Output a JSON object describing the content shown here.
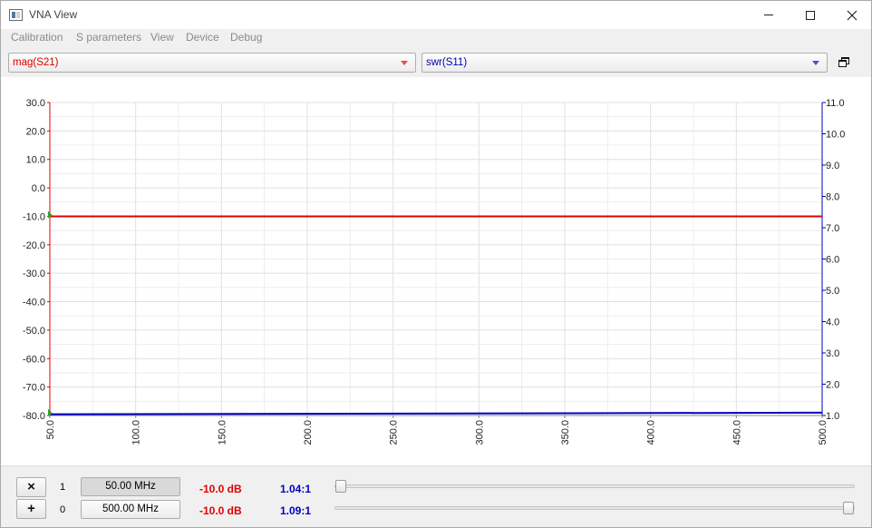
{
  "window": {
    "title": "VNA View"
  },
  "menu": [
    "Calibration",
    "S parameters",
    "View",
    "Device",
    "Debug"
  ],
  "toolbar": {
    "trace1": "mag(S21)",
    "trace2": "swr(S11)",
    "colors": {
      "trace1": "#e00000",
      "trace2": "#0000c0"
    }
  },
  "chart_data": {
    "type": "line",
    "x": [
      50,
      500
    ],
    "x_ticks": [
      "50.0",
      "100.0",
      "150.0",
      "200.0",
      "250.0",
      "300.0",
      "350.0",
      "400.0",
      "450.0",
      "500.0"
    ],
    "xlim": [
      50,
      500
    ],
    "left_axis": {
      "ylim": [
        -80,
        30
      ],
      "ticks": [
        "30.0",
        "20.0",
        "10.0",
        "0.0",
        "-10.0",
        "-20.0",
        "-30.0",
        "-40.0",
        "-50.0",
        "-60.0",
        "-70.0",
        "-80.0"
      ],
      "color": "#e00000"
    },
    "right_axis": {
      "ylim": [
        1,
        11
      ],
      "ticks": [
        "11.0",
        "10.0",
        "9.0",
        "8.0",
        "7.0",
        "6.0",
        "5.0",
        "4.0",
        "3.0",
        "2.0",
        "1.0"
      ],
      "color": "#0000c0"
    },
    "grid": true,
    "series": [
      {
        "values": [
          -10.0,
          -10.0
        ],
        "axis": "left",
        "color": "#e00000"
      },
      {
        "values": [
          1.04,
          1.09
        ],
        "axis": "right",
        "color": "#0000c0"
      }
    ]
  },
  "markers": [
    {
      "button": "×",
      "index": "1",
      "freq": "50.00 MHz",
      "db": "-10.0 dB",
      "swr": "1.04:1",
      "slider_fraction": 0.0
    },
    {
      "button": "+",
      "index": "0",
      "freq": "500.00 MHz",
      "db": "-10.0 dB",
      "swr": "1.09:1",
      "slider_fraction": 1.0
    }
  ]
}
